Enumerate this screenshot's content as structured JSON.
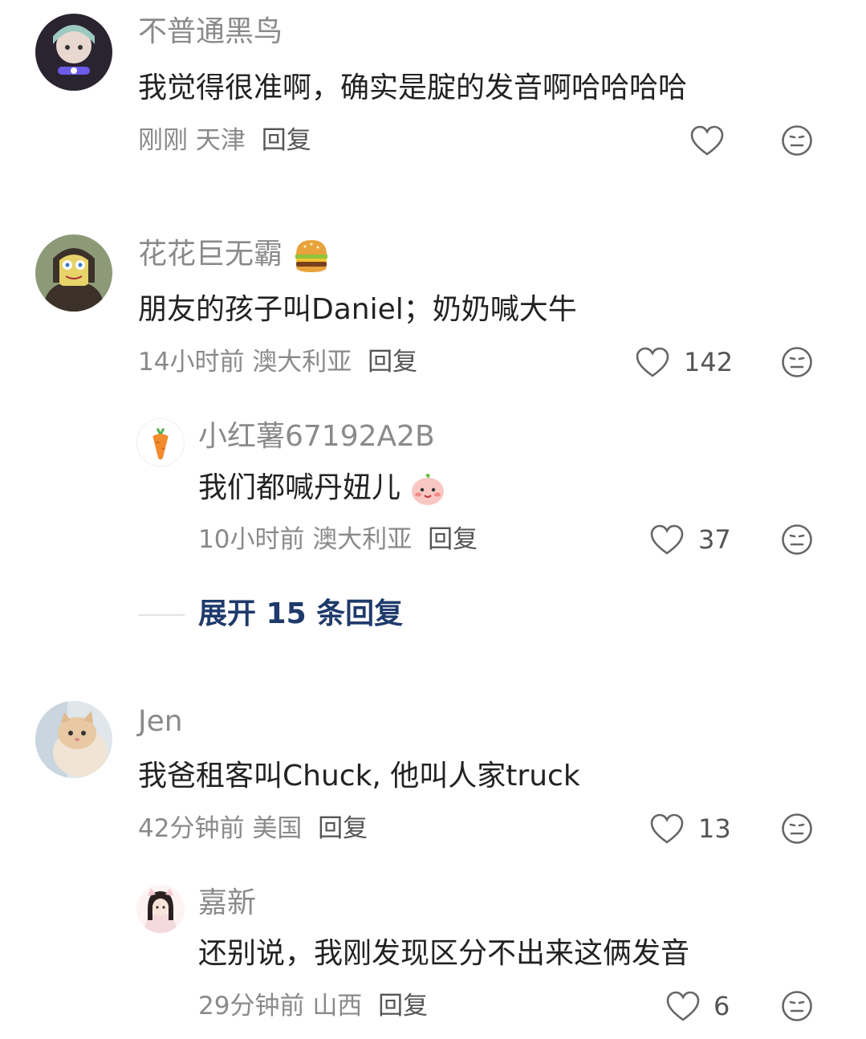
{
  "comments": [
    {
      "username": "不普通黑鸟",
      "text": "我觉得很准啊，确实是腚的发音啊哈哈哈哈",
      "time": "刚刚",
      "location": "天津",
      "reply_label": "回复",
      "likes": ""
    },
    {
      "username": "花花巨无霸",
      "username_emoji": "burger-emoji",
      "text": "朋友的孩子叫Daniel；奶奶喊大牛",
      "time": "14小时前",
      "location": "澳大利亚",
      "reply_label": "回复",
      "likes": "142",
      "replies": [
        {
          "username": "小红薯67192A2B",
          "text": "我们都喊丹妞儿",
          "text_emoji": "blush-emoji",
          "time": "10小时前",
          "location": "澳大利亚",
          "reply_label": "回复",
          "likes": "37"
        }
      ],
      "expand_label": "展开 15 条回复"
    },
    {
      "username": "Jen",
      "text": "我爸租客叫Chuck, 他叫人家truck",
      "time": "42分钟前",
      "location": "美国",
      "reply_label": "回复",
      "likes": "13",
      "replies": [
        {
          "username": "嘉新",
          "text": "还别说，我刚发现区分不出来这俩发音",
          "time": "29分钟前",
          "location": "山西",
          "reply_label": "回复",
          "likes": "6"
        }
      ]
    }
  ],
  "colors": {
    "username": "#8a8a8a",
    "text": "#222222",
    "expand_link": "#1f3a6b",
    "divider": "#e2e2e2"
  },
  "icons": [
    "heart-icon",
    "meh-face-icon"
  ]
}
